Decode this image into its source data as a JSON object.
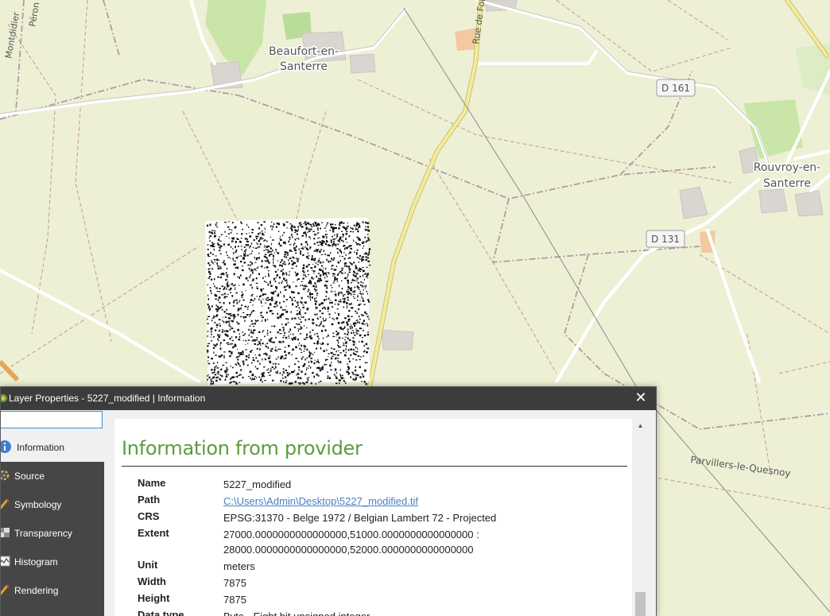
{
  "map": {
    "places": {
      "beaufort_line1": "Beaufort-en-",
      "beaufort_line2": "Santerre",
      "rouvroy_line1": "Rouvroy-en-",
      "rouvroy_line2": "Santerre",
      "parvillers": "Parvillers-le-Quesnoy",
      "montdidier": "Montdidier",
      "peronne": "Péron",
      "rue_de_folie": "Rue de Foli"
    },
    "roads": {
      "d161": "D 161",
      "d131": "D 131"
    }
  },
  "dialog": {
    "title": "Layer Properties - 5227_modified | Information",
    "close_glyph": "✕",
    "search_value": "",
    "nav": [
      {
        "label": "Information",
        "icon": "info-icon",
        "active": true
      },
      {
        "label": "Source",
        "icon": "source-icon"
      },
      {
        "label": "Symbology",
        "icon": "symbology-icon"
      },
      {
        "label": "Transparency",
        "icon": "transparency-icon"
      },
      {
        "label": "Histogram",
        "icon": "histogram-icon"
      },
      {
        "label": "Rendering",
        "icon": "rendering-icon"
      }
    ],
    "content": {
      "heading": "Information from provider",
      "rows": [
        {
          "key": "Name",
          "value": "5227_modified"
        },
        {
          "key": "Path",
          "value": "C:\\Users\\Admin\\Desktop\\5227_modified.tif"
        },
        {
          "key": "CRS",
          "value": "EPSG:31370 - Belge 1972 / Belgian Lambert 72 - Projected"
        },
        {
          "key": "Extent",
          "value": "27000.0000000000000000,51000.0000000000000000 :",
          "value2": "28000.0000000000000000,52000.0000000000000000"
        },
        {
          "key": "Unit",
          "value": "meters"
        },
        {
          "key": "Width",
          "value": "7875"
        },
        {
          "key": "Height",
          "value": "7875"
        },
        {
          "key": "Data type",
          "value": "Byte - Eight bit unsigned integer"
        }
      ]
    },
    "colors": {
      "heading_green": "#5b9d3c",
      "link_blue": "#4a7fc1",
      "sidebar_dark": "#464646"
    }
  }
}
